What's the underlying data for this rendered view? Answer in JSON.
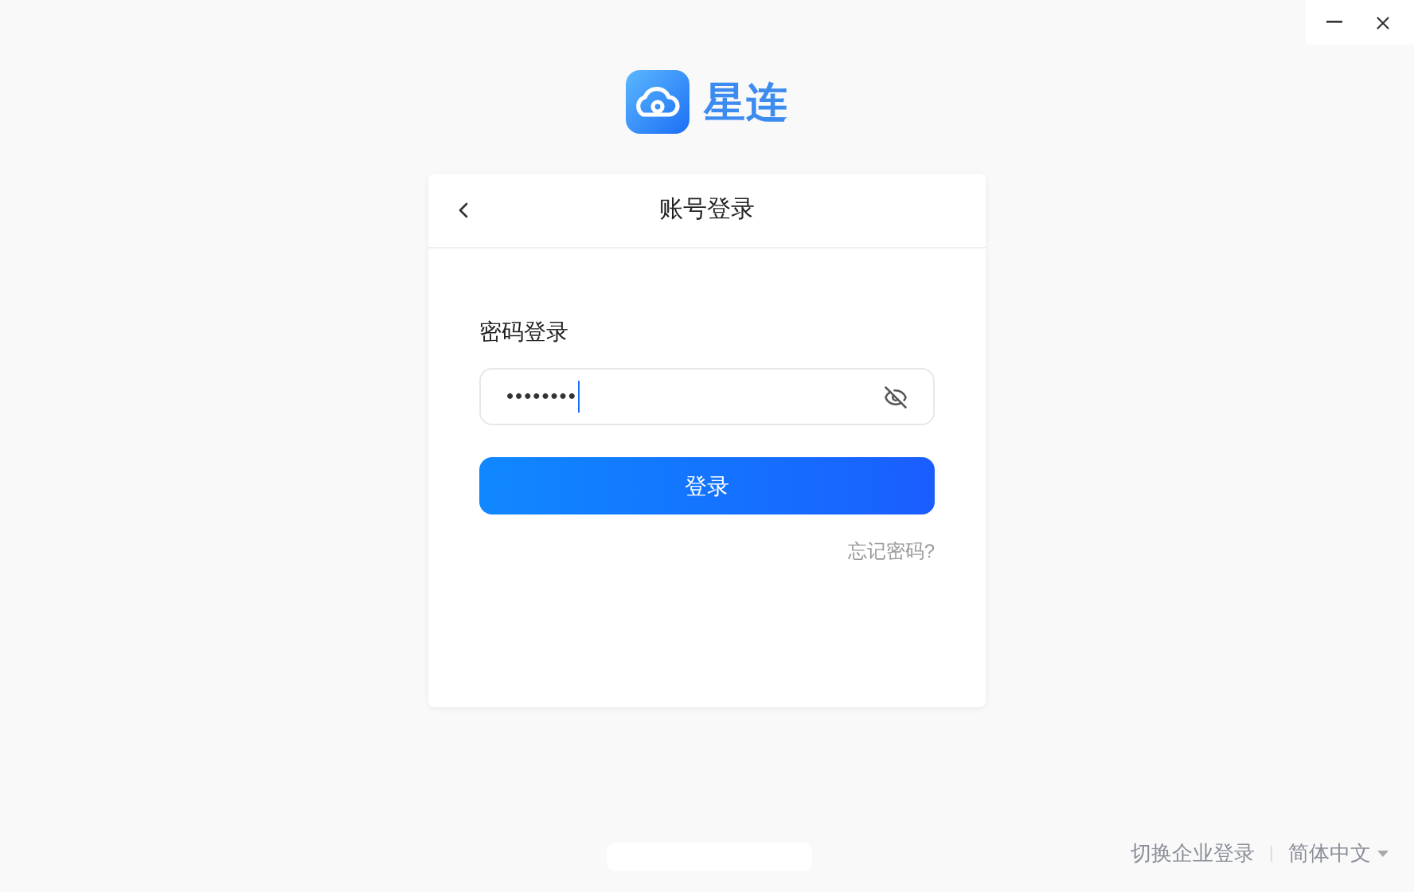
{
  "app": {
    "name": "星连"
  },
  "card": {
    "title": "账号登录",
    "section_label": "密码登录",
    "password": {
      "value": "••••••••",
      "focused": true
    },
    "submit": "登录",
    "forgot": "忘记密码?"
  },
  "footer": {
    "enterprise_link": "切换企业登录",
    "language": "简体中文"
  }
}
